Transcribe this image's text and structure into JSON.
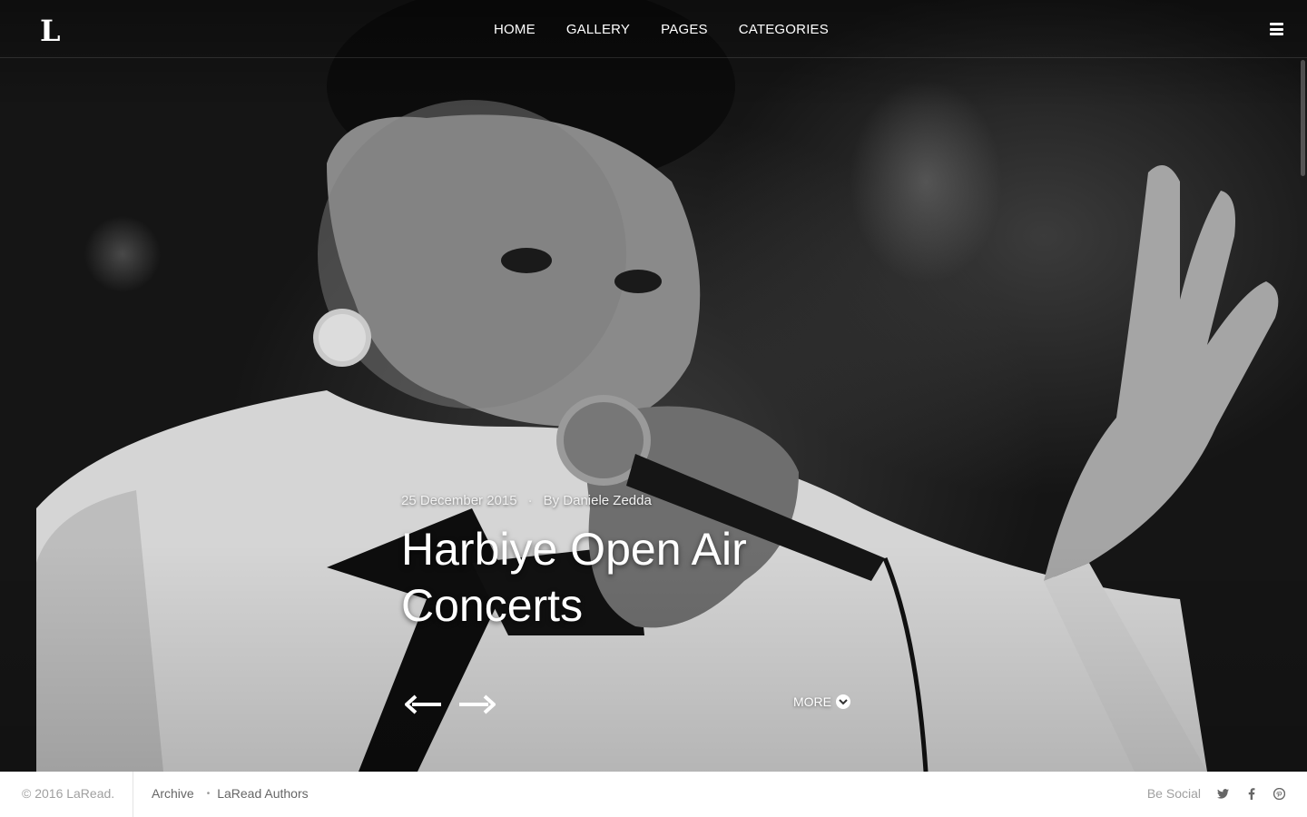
{
  "logo": {
    "text": "L"
  },
  "nav": {
    "items": [
      "HOME",
      "GALLERY",
      "PAGES",
      "CATEGORIES"
    ],
    "menu_icon": "hamburger-icon"
  },
  "post": {
    "date": "25 December 2015",
    "separator": "·",
    "author": "By Daniele Zedda",
    "title": "Harbiye Open Air Concerts",
    "more_label": "MORE",
    "more_icon": "chevron-down-circle-icon",
    "prev_icon": "arrow-left-icon",
    "next_icon": "arrow-right-icon"
  },
  "footer": {
    "copyright": "© 2016 LaRead.",
    "links": [
      "Archive",
      "LaRead Authors"
    ],
    "link_separator": "•",
    "social_label": "Be Social",
    "social_icons": [
      "twitter-icon",
      "facebook-icon",
      "pinterest-icon"
    ]
  },
  "colors": {
    "footer_bg": "#ffffff",
    "nav_text": "#ffffff",
    "footer_text": "#888888"
  }
}
